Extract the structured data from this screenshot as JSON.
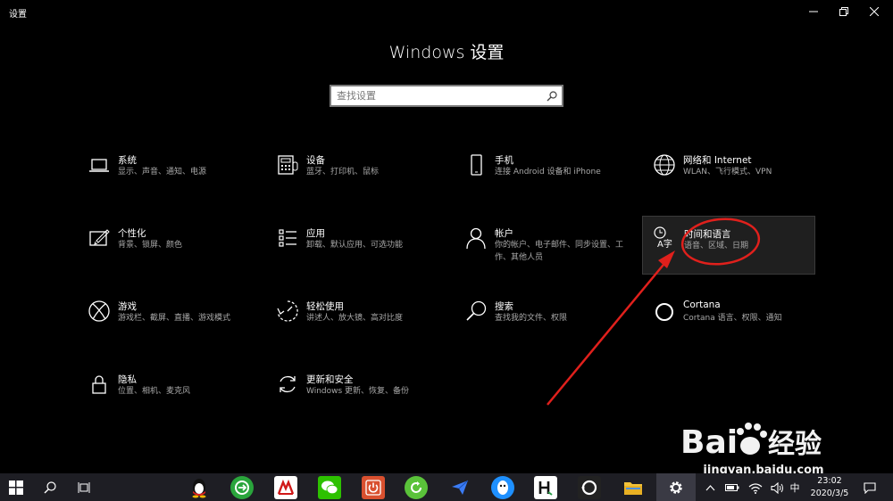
{
  "window": {
    "title": "设置"
  },
  "header": {
    "title": "Windows 设置",
    "search_placeholder": "查找设置"
  },
  "tiles": [
    {
      "title": "系统",
      "desc": "显示、声音、通知、电源",
      "icon": "laptop-icon"
    },
    {
      "title": "设备",
      "desc": "蓝牙、打印机、鼠标",
      "icon": "keyboard-icon"
    },
    {
      "title": "手机",
      "desc": "连接 Android 设备和 iPhone",
      "icon": "phone-icon"
    },
    {
      "title": "网络和 Internet",
      "desc": "WLAN、飞行模式、VPN",
      "icon": "globe-icon"
    },
    {
      "title": "个性化",
      "desc": "背景、锁屏、颜色",
      "icon": "paint-icon"
    },
    {
      "title": "应用",
      "desc": "卸载、默认应用、可选功能",
      "icon": "apps-list-icon"
    },
    {
      "title": "帐户",
      "desc": "你的帐户、电子邮件、同步设置、工作、其他人员",
      "icon": "person-icon"
    },
    {
      "title": "时间和语言",
      "desc": "语音、区域、日期",
      "icon": "time-language-icon"
    },
    {
      "title": "游戏",
      "desc": "游戏栏、截屏、直播、游戏模式",
      "icon": "xbox-icon"
    },
    {
      "title": "轻松使用",
      "desc": "讲述人、放大镜、高对比度",
      "icon": "ease-of-access-icon"
    },
    {
      "title": "搜索",
      "desc": "查找我的文件、权限",
      "icon": "search-icon"
    },
    {
      "title": "Cortana",
      "desc": "Cortana 语言、权限、通知",
      "icon": "cortana-icon"
    },
    {
      "title": "隐私",
      "desc": "位置、相机、麦克风",
      "icon": "lock-icon"
    },
    {
      "title": "更新和安全",
      "desc": "Windows 更新、恢复、备份",
      "icon": "sync-icon"
    }
  ],
  "watermark": {
    "brand": "Bai经验",
    "url": "jingyan.baidu.com"
  },
  "taskbar": {
    "ime": "中",
    "time": "23:02",
    "date": "2020/3/5",
    "apps": [
      "qq",
      "browser",
      "pdf",
      "wechat",
      "power",
      "refresh",
      "feishu",
      "qq-alt",
      "h-app",
      "camera",
      "files",
      "settings"
    ]
  },
  "colors": {
    "background": "#000000",
    "taskbar": "#1e1e24",
    "annotation": "#e0201c",
    "description": "#a8a8a8"
  }
}
